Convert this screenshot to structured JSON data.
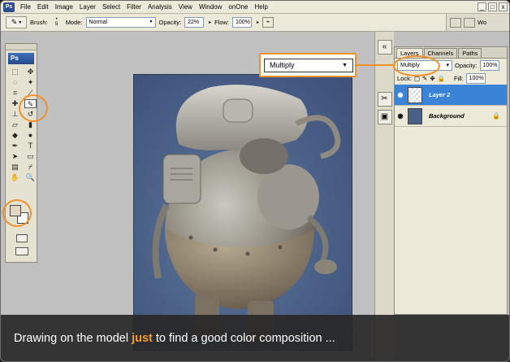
{
  "app": {
    "badge": "Ps"
  },
  "menu": [
    "File",
    "Edit",
    "Image",
    "Layer",
    "Select",
    "Filter",
    "Analysis",
    "View",
    "Window",
    "onOne",
    "Help"
  ],
  "window_controls": {
    "minimize": "_",
    "restore": "□",
    "close": "x"
  },
  "options": {
    "brush_label": "Brush:",
    "brush_size": "5",
    "mode_label": "Mode:",
    "mode_value": "Normal",
    "opacity_label": "Opacity:",
    "opacity_value": "22%",
    "flow_label": "Flow:",
    "flow_value": "100%",
    "workspace_label": "Wo"
  },
  "toolbox": {
    "logo": "Ps"
  },
  "layers_panel": {
    "tabs": [
      "Layers",
      "Channels",
      "Paths"
    ],
    "blend_mode": "Multiply",
    "opacity_label": "Opacity:",
    "opacity_value": "100%",
    "lock_label": "Lock:",
    "fill_label": "Fill:",
    "fill_value": "100%",
    "layers": [
      {
        "name": "Layer 2",
        "selected": true
      },
      {
        "name": "Background",
        "selected": false
      }
    ]
  },
  "callout": {
    "blend_mode": "Multiply"
  },
  "caption": {
    "before": "Drawing on the model ",
    "highlight": "just",
    "after": " to find a good color composition ..."
  },
  "colors": {
    "accent": "#f0912a",
    "selection": "#3b83d6",
    "canvas_bg": "#4a6087",
    "foreground": "#e3d9c3"
  },
  "icons": [
    "ps-icon",
    "brush-icon",
    "eye-icon",
    "lock-icon",
    "move-icon",
    "marquee-icon",
    "lasso-icon",
    "wand-icon",
    "crop-icon",
    "slice-icon",
    "healing-icon",
    "pencil-icon",
    "stamp-icon",
    "history-brush-icon",
    "eraser-icon",
    "gradient-icon",
    "blur-icon",
    "dodge-icon",
    "pen-icon",
    "type-icon",
    "path-select-icon",
    "shape-icon",
    "notes-icon",
    "eyedropper-icon",
    "hand-icon",
    "zoom-icon"
  ]
}
